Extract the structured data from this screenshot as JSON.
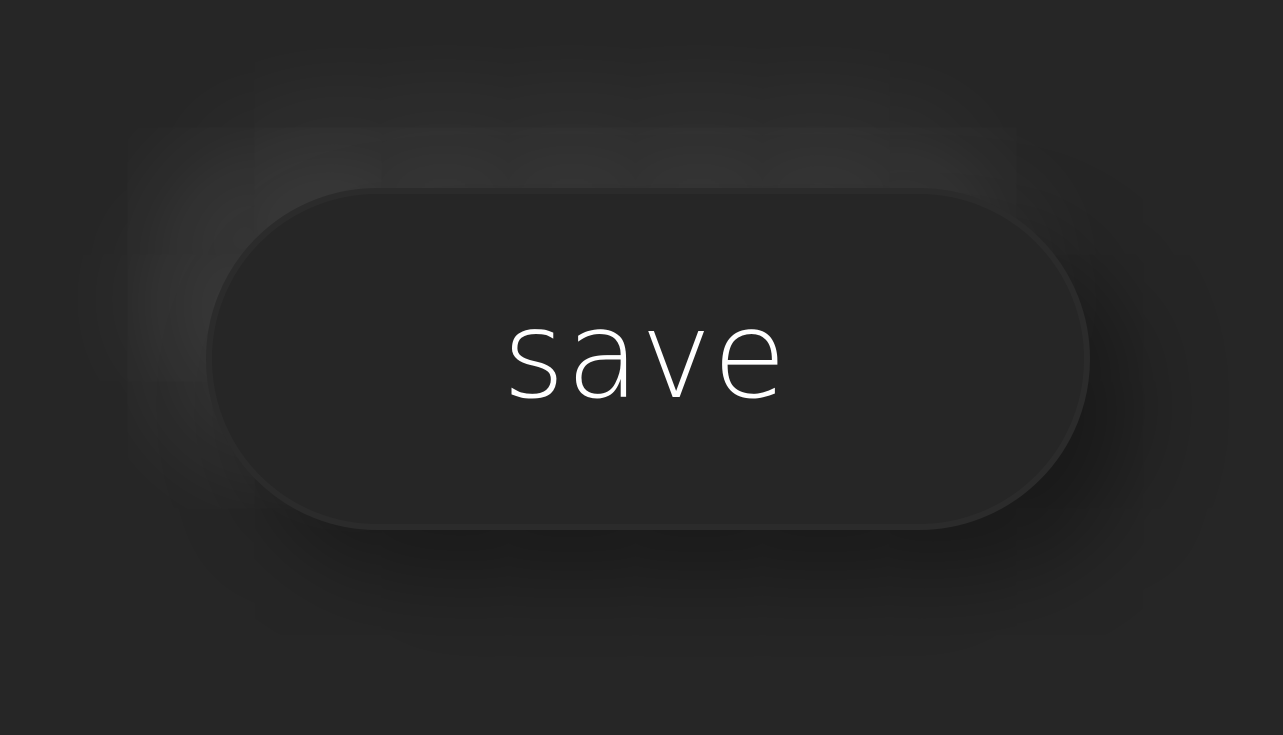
{
  "button": {
    "label": "save"
  },
  "colors": {
    "background": "#262626",
    "button_fill": "#262626",
    "button_border": "#2b2b2b",
    "text": "#ffffff"
  }
}
